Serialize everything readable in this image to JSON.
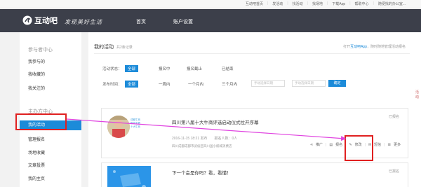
{
  "topbar": {
    "links": [
      "互动吧首页",
      "发活动",
      "找活动",
      "找场地",
      "下载App",
      "帮助中心"
    ],
    "user": "随便找的办公室..."
  },
  "nav": {
    "brand": "互动吧",
    "slogan": "发现美好生活",
    "items": [
      "首页",
      "账户设置"
    ]
  },
  "sidebar": {
    "group1": "参与者中心",
    "group1_items": [
      "我参与的",
      "我收藏的",
      "我关注的"
    ],
    "group2": "主办方中心",
    "group2_items": [
      "我的活动",
      "管理报名",
      "场地收藏",
      "文章投票",
      "我的主页"
    ],
    "active": "我的活动"
  },
  "main": {
    "title": "我的活动",
    "count": "共2条记录",
    "app_hint_prefix": "打开",
    "app_hint_link": "互动吧App",
    "app_hint_suffix": "，随时随地管理活动报名",
    "status_label": "活动状态：",
    "status_options": [
      "全部",
      "报名中",
      "报名截止",
      "已结束"
    ],
    "time_label": "发布时间：",
    "time_options": [
      "全部",
      "一周内",
      "一个月内",
      "三个月内"
    ],
    "date_start_placeholder": "手动选择日期",
    "date_end_placeholder": "手动选择日期",
    "confirm": "确定"
  },
  "card1": {
    "title": "四川第八届十大牛商评选启动仪式拉开序幕",
    "status": "已报名",
    "datetime": "2016-11-15 18:21 发布",
    "signups": "报名人数：0人",
    "address": "四川成都成都市武侯区四川国小楠城消费店",
    "mini_lines": [
      "成都牛商",
      "带你来看",
      "十大牛商"
    ],
    "actions": [
      "推广",
      "报名",
      "修改",
      "短信",
      "更多"
    ]
  },
  "card2": {
    "title": "下一个会是你吗？看，看懂！",
    "status": "已报名"
  },
  "right_edge_text": "活动"
}
